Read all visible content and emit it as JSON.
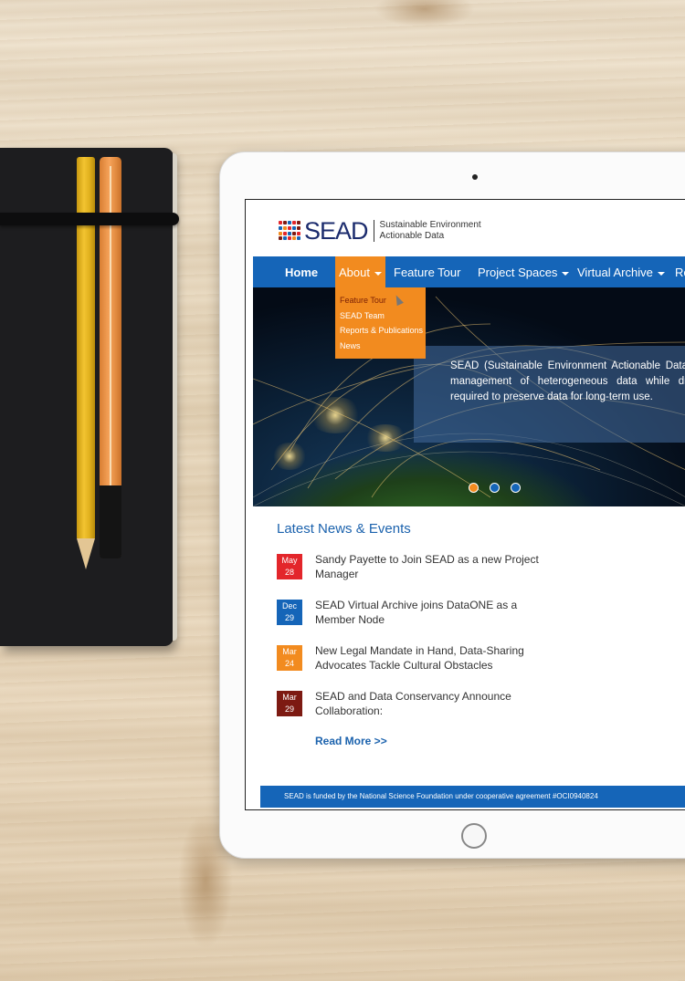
{
  "site": {
    "logo_text": "SEAD",
    "tagline_line1": "Sustainable Environment",
    "tagline_line2": "Actionable Data",
    "brand_color": "#1565b8",
    "accent_color": "#f28b1f"
  },
  "nav": {
    "items": [
      {
        "label": "Home"
      },
      {
        "label": "About"
      },
      {
        "label": "Feature Tour"
      },
      {
        "label": "Project Spaces"
      },
      {
        "label": "Virtual Archive"
      },
      {
        "label": "Re"
      }
    ]
  },
  "about_menu": {
    "items": [
      "Feature Tour",
      "SEAD Team",
      "Reports & Publications",
      "News"
    ]
  },
  "hero": {
    "text": "SEAD (Sustainable Environment Actionable Data management of heterogeneous data while dr required to preserve data for long-term use."
  },
  "news": {
    "title": "Latest News & Events",
    "items": [
      {
        "month": "May",
        "day": "28",
        "color": "#e3262b",
        "text": "Sandy Payette to Join SEAD as a new Project Manager"
      },
      {
        "month": "Dec",
        "day": "29",
        "color": "#1565b8",
        "text": "SEAD Virtual Archive joins DataONE as a Member Node"
      },
      {
        "month": "Mar",
        "day": "24",
        "color": "#f28b1f",
        "text": "New Legal Mandate in Hand, Data-Sharing Advocates Tackle Cultural Obstacles"
      },
      {
        "month": "Mar",
        "day": "29",
        "color": "#7d1a12",
        "text": "SEAD and Data Conservancy Announce Collaboration:"
      }
    ],
    "read_more": "Read More >>"
  },
  "footer": {
    "text": "SEAD is funded by the National Science Foundation under cooperative agreement #OCI0940824"
  }
}
